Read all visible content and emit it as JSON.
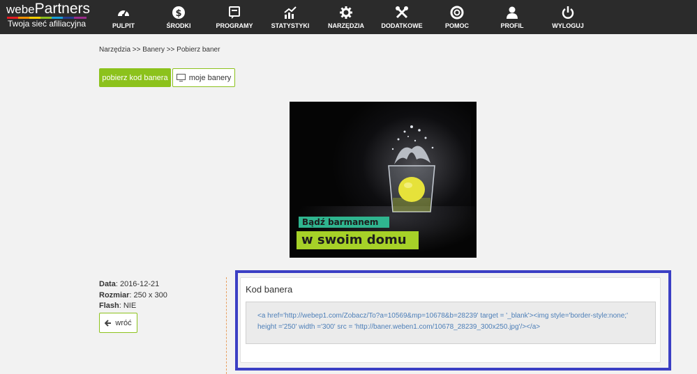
{
  "brand": {
    "name_prefix": "webe",
    "name_main": "Partners",
    "tagline": "Twoja sieć afiliacyjna"
  },
  "nav": {
    "items": [
      {
        "label": "PULPIT",
        "icon": "dashboard-icon"
      },
      {
        "label": "ŚRODKI",
        "icon": "dollar-icon"
      },
      {
        "label": "PROGRAMY",
        "icon": "programs-icon"
      },
      {
        "label": "STATYSTYKI",
        "icon": "chart-icon"
      },
      {
        "label": "NARZĘDZIA",
        "icon": "gear-icon"
      },
      {
        "label": "DODATKOWE",
        "icon": "wrench-icon"
      },
      {
        "label": "POMOC",
        "icon": "lifebuoy-icon"
      },
      {
        "label": "PROFIL",
        "icon": "user-icon"
      },
      {
        "label": "WYLOGUJ",
        "icon": "power-icon"
      }
    ]
  },
  "breadcrumb": "Narzędzia >> Banery >> Pobierz baner",
  "actions": {
    "get_code_label": "pobierz kod banera",
    "my_banners_label": "moje banery"
  },
  "banner": {
    "line1": "Bądź barmanem",
    "line2": "w swoim domu"
  },
  "meta": {
    "date_label": "Data",
    "date_value": ": 2016-12-21",
    "size_label": "Rozmiar",
    "size_value": ": 250 x 300",
    "flash_label": "Flash",
    "flash_value": ": NIE"
  },
  "back_label": "wróć",
  "code_panel": {
    "title": "Kod banera",
    "code": "<a href='http://webep1.com/Zobacz/To?a=10569&mp=10678&b=28239' target = '_blank'><img style='border-style:none;' height ='250' width ='300' src = 'http://baner.weben1.com/10678_28239_300x250.jpg'/></a>"
  },
  "colors": {
    "accent_green": "#8cc21c",
    "nav_bg": "#2b2b2b",
    "highlight_border": "#3b3fc4",
    "code_text": "#4d7fb8"
  }
}
